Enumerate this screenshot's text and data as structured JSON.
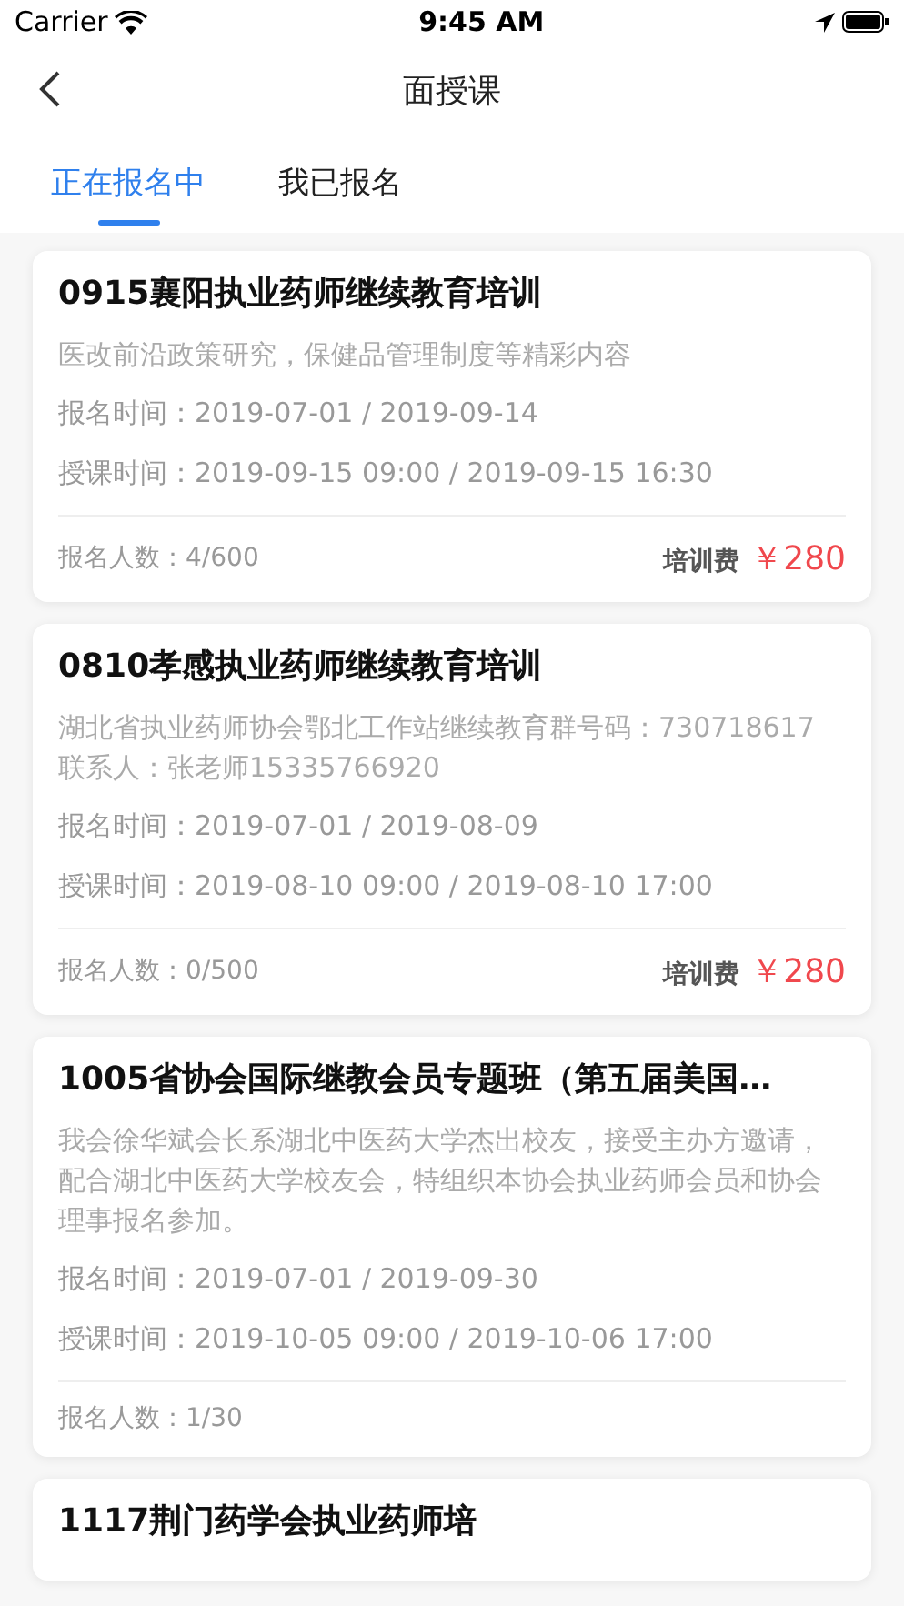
{
  "status_bar": {
    "carrier": "Carrier",
    "time": "9:45 AM"
  },
  "nav": {
    "title": "面授课"
  },
  "tabs": [
    {
      "label": "正在报名中",
      "selected": true
    },
    {
      "label": "我已报名",
      "selected": false
    }
  ],
  "courses": [
    {
      "title": "0915襄阳执业药师继续教育培训",
      "description": "医改前沿政策研究，保健品管理制度等精彩内容",
      "signup_time": "报名时间：2019-07-01 / 2019-09-14",
      "class_time": "授课时间：2019-09-15 09:00 / 2019-09-15 16:30",
      "enrolled": "报名人数：4/600",
      "fee_label": "培训费",
      "fee": "￥280"
    },
    {
      "title": "0810孝感执业药师继续教育培训",
      "description": "湖北省执业药师协会鄂北工作站继续教育群号码：730718617　联系人：张老师15335766920",
      "signup_time": "报名时间：2019-07-01 / 2019-08-09",
      "class_time": "授课时间：2019-08-10 09:00 / 2019-08-10 17:00",
      "enrolled": "报名人数：0/500",
      "fee_label": "培训费",
      "fee": "￥280"
    },
    {
      "title": "1005省协会国际继教会员专题班（第五届美国…",
      "description": "我会徐华斌会长系湖北中医药大学杰出校友，接受主办方邀请，配合湖北中医药大学校友会，特组织本协会执业药师会员和协会理事报名参加。",
      "signup_time": "报名时间：2019-07-01 / 2019-09-30",
      "class_time": "授课时间：2019-10-05 09:00 / 2019-10-06 17:00",
      "enrolled": "报名人数：1/30"
    },
    {
      "title": "1117荆门药学会执业药师培"
    }
  ]
}
